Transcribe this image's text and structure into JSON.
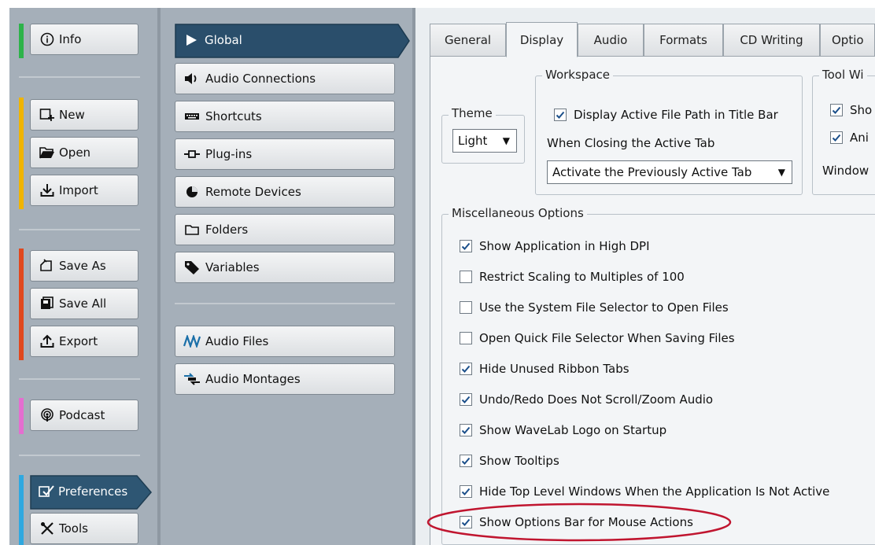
{
  "left_nav": {
    "info": "Info",
    "new": "New",
    "open": "Open",
    "import": "Import",
    "save_as": "Save As",
    "save_all": "Save All",
    "export": "Export",
    "podcast": "Podcast",
    "preferences": "Preferences",
    "tools": "Tools",
    "bar_colors": {
      "info": "#2db34a",
      "file": "#f0b400",
      "save": "#e0481e",
      "podcast": "#e46ed0",
      "prefs": "#2fa8e0"
    }
  },
  "pref_nav": {
    "global": "Global",
    "audio_connections": "Audio Connections",
    "shortcuts": "Shortcuts",
    "plugins": "Plug-ins",
    "remote_devices": "Remote Devices",
    "folders": "Folders",
    "variables": "Variables",
    "audio_files": "Audio Files",
    "audio_montages": "Audio Montages"
  },
  "tabs": [
    "General",
    "Display",
    "Audio",
    "Formats",
    "CD Writing",
    "Optio"
  ],
  "active_tab": "Display",
  "theme": {
    "legend": "Theme",
    "value": "Light"
  },
  "workspace": {
    "legend": "Workspace",
    "display_path_label": "Display Active File Path in Title Bar",
    "display_path_checked": true,
    "closing_label": "When Closing the Active Tab",
    "closing_value": "Activate the Previously Active Tab"
  },
  "tool_windows": {
    "legend": "Tool Wi",
    "item1": "Sho",
    "item2": "Ani",
    "item3": "Window"
  },
  "misc": {
    "legend": "Miscellaneous Options",
    "options": [
      {
        "label": "Show Application in High DPI",
        "checked": true
      },
      {
        "label": "Restrict Scaling to Multiples of 100",
        "checked": false
      },
      {
        "label": "Use the System File Selector to Open Files",
        "checked": false
      },
      {
        "label": "Open Quick File Selector When Saving Files",
        "checked": false
      },
      {
        "label": "Hide Unused Ribbon Tabs",
        "checked": true
      },
      {
        "label": "Undo/Redo Does Not Scroll/Zoom Audio",
        "checked": true
      },
      {
        "label": "Show WaveLab Logo on Startup",
        "checked": true
      },
      {
        "label": "Show Tooltips",
        "checked": true
      },
      {
        "label": "Hide Top Level Windows When the Application Is Not Active",
        "checked": true
      },
      {
        "label": "Show Options Bar for Mouse Actions",
        "checked": true
      }
    ]
  },
  "highlight_color": "#c0152f"
}
